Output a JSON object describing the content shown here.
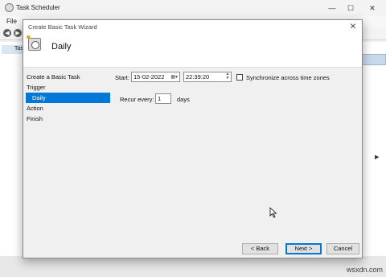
{
  "app": {
    "title": "Task Scheduler",
    "menu_file": "File",
    "tree_label": "Tas"
  },
  "window_controls": {
    "minimize": "—",
    "maximize": "☐",
    "close": "✕"
  },
  "wizard": {
    "title": "Create Basic Task Wizard",
    "heading": "Daily",
    "close": "✕",
    "steps": [
      "Create a Basic Task",
      "Trigger",
      "Daily",
      "Action",
      "Finish"
    ],
    "active_step": "Daily",
    "start_label": "Start:",
    "start_date": "15-02-2022",
    "start_time": "22:39:20",
    "sync_label": "Synchronize across time zones",
    "sync_checked": false,
    "recur_label": "Recur every:",
    "recur_value": "1",
    "recur_unit": "days",
    "back_button": "< Back",
    "next_button": "Next >",
    "cancel_button": "Cancel"
  },
  "watermark": "wsxdn.com",
  "colors": {
    "accent": "#0078d7",
    "dialog_bg": "#f0f0f0"
  }
}
